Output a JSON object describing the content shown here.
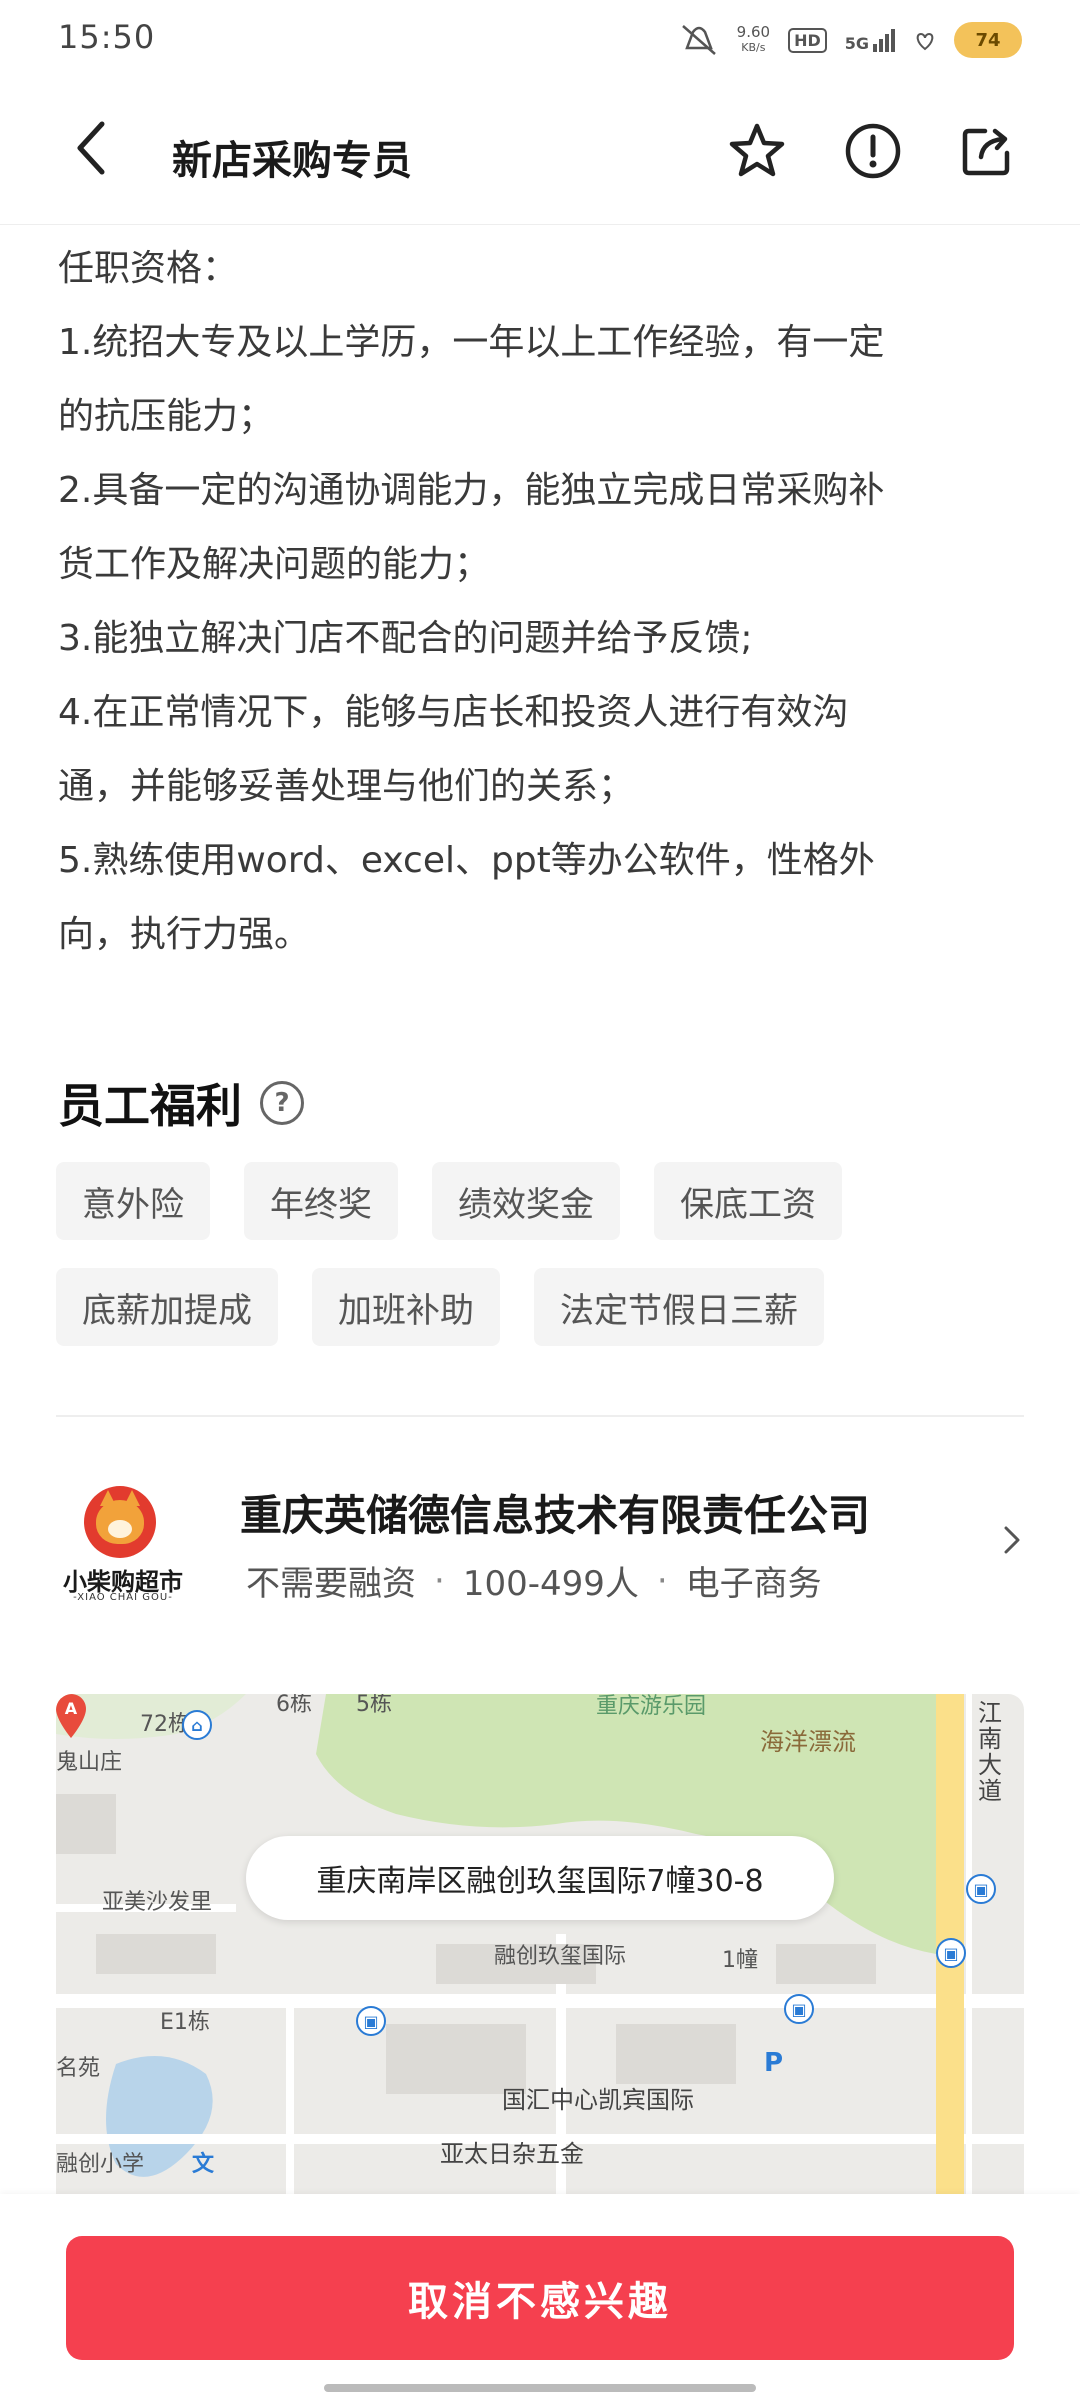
{
  "status_bar": {
    "time": "15:50",
    "net_speed_value": "9.60",
    "net_speed_unit": "KB/s",
    "hd": "HD",
    "network": "5G",
    "battery": "74"
  },
  "header": {
    "title": "新店采购专员"
  },
  "description": {
    "lines": [
      "任职资格：",
      "1.统招大专及以上学历，一年以上工作经验，有一定",
      "的抗压能力；",
      "2.具备一定的沟通协调能力，能独立完成日常采购补",
      "货工作及解决问题的能力；",
      "3.能独立解决门店不配合的问题并给予反馈;",
      "4.在正常情况下，能够与店长和投资人进行有效沟",
      "通，并能够妥善处理与他们的关系；",
      "5.熟练使用word、excel、ppt等办公软件，性格外",
      "向，执行力强。"
    ]
  },
  "benefits": {
    "title": "员工福利",
    "help_icon": "?",
    "tags": [
      "意外险",
      "年终奖",
      "绩效奖金",
      "保底工资",
      "底薪加提成",
      "加班补助",
      "法定节假日三薪"
    ]
  },
  "company": {
    "logo_text": "小柴购超市",
    "logo_subtext": "-XIAO CHAI GOU-",
    "name": "重庆英储德信息技术有限责任公司",
    "financing": "不需要融资",
    "size": "100-499人",
    "industry": "电子商务",
    "separator": "·"
  },
  "map": {
    "address": "重庆南岸区融创玖玺国际7幢30-8",
    "pin_letter": "A",
    "labels": {
      "l1": "72栋",
      "l2": "6栋",
      "l3": "5栋",
      "l4": "重庆游乐园",
      "l5": "海洋漂流",
      "l6": "江南大道",
      "l7": "鬼山庄",
      "l8": "亚美沙发里",
      "l9": "融创玖玺国际",
      "l10": "1幢",
      "l11": "E1栋",
      "l12": "名苑",
      "l13": "国汇中心凯宾国际",
      "l14": "融创小学",
      "l15": "亚太日杂五金",
      "l16": "文",
      "l17": "P"
    }
  },
  "bottom": {
    "cancel_button": "取消不感兴趣"
  },
  "icons": {
    "back": "back-arrow-icon",
    "star": "star-icon",
    "report": "warning-icon",
    "share": "share-icon",
    "arrow": "chevron-right-icon"
  },
  "colors": {
    "primary_button": "#f5404f",
    "tag_bg": "#f4f4f4",
    "battery": "#f3c25a"
  }
}
